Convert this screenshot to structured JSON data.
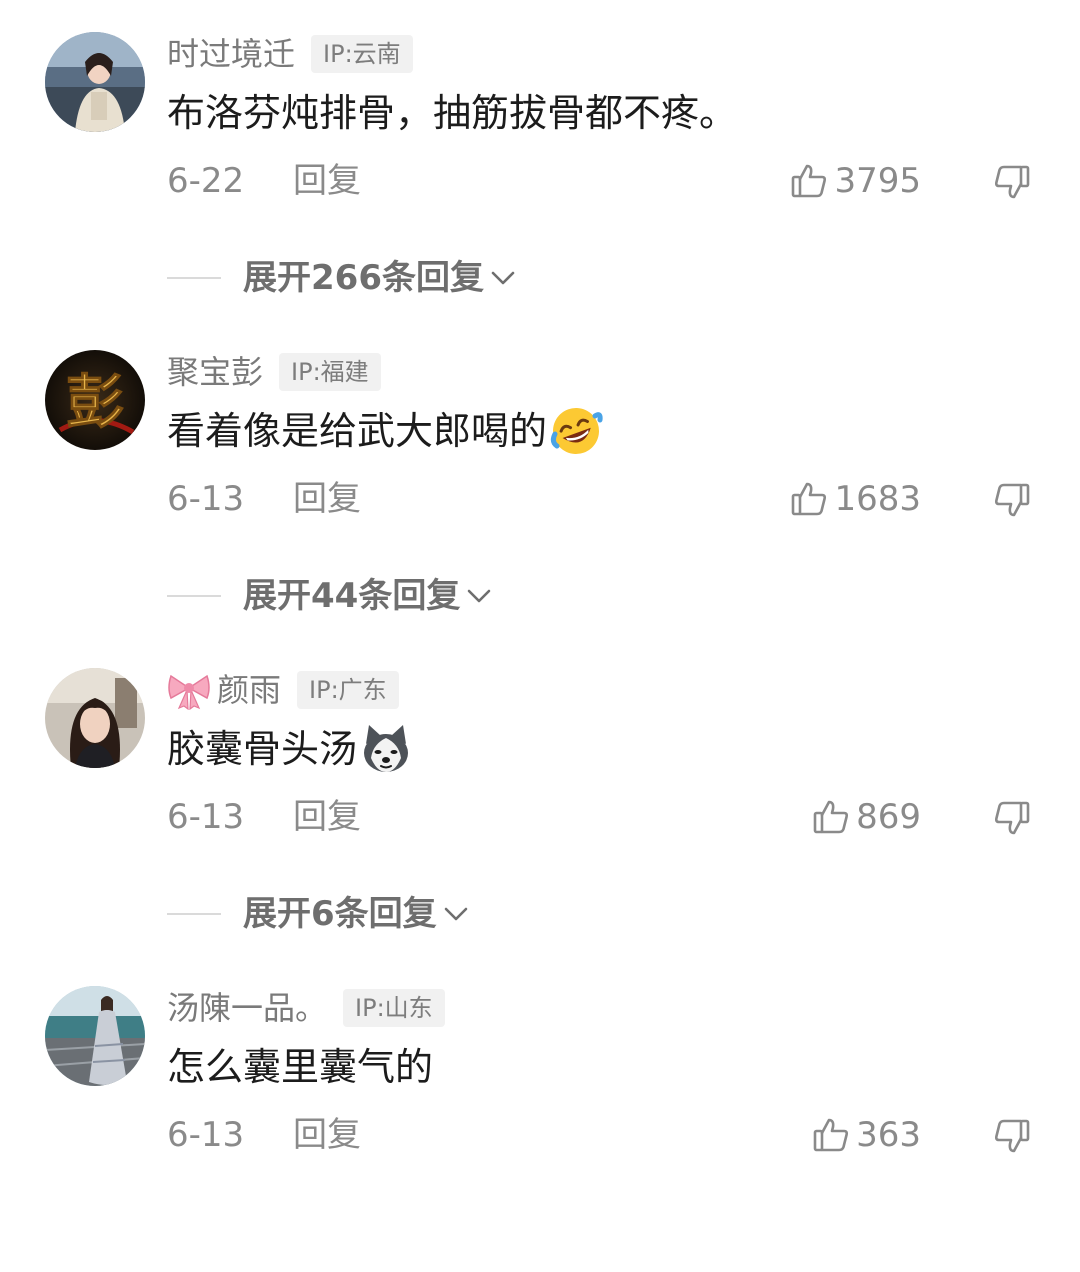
{
  "comments": [
    {
      "username": "时过境迁",
      "ip": "IP:云南",
      "text": "布洛芬炖排骨，抽筋拔骨都不疼。",
      "date": "6-22",
      "reply_label": "回复",
      "likes": "3795",
      "expand_label": "展开266条回复"
    },
    {
      "username": "聚宝彭",
      "ip": "IP:福建",
      "text": "看着像是给武大郎喝的",
      "avatar_char": "彭",
      "date": "6-13",
      "reply_label": "回复",
      "likes": "1683",
      "expand_label": "展开44条回复"
    },
    {
      "username": "颜雨",
      "ip": "IP:广东",
      "text": "胶囊骨头汤",
      "date": "6-13",
      "reply_label": "回复",
      "likes": "869",
      "expand_label": "展开6条回复"
    },
    {
      "username": "汤陳一品。",
      "ip": "IP:山东",
      "text": "怎么囊里囊气的",
      "date": "6-13",
      "reply_label": "回复",
      "likes": "363"
    }
  ],
  "icons": {
    "like": "thumbs-up-outline",
    "dislike": "thumbs-down-outline",
    "expand": "chevron-down",
    "emoji_comment_2": "rofl-face",
    "emoji_comment_3": "husky-dog-face",
    "username_badge_3": "pink-bow"
  },
  "colors": {
    "username": "#7a7a7a",
    "text": "#1c1c1c",
    "meta": "#8a8a8a",
    "badge_bg": "#f1f1f1"
  }
}
